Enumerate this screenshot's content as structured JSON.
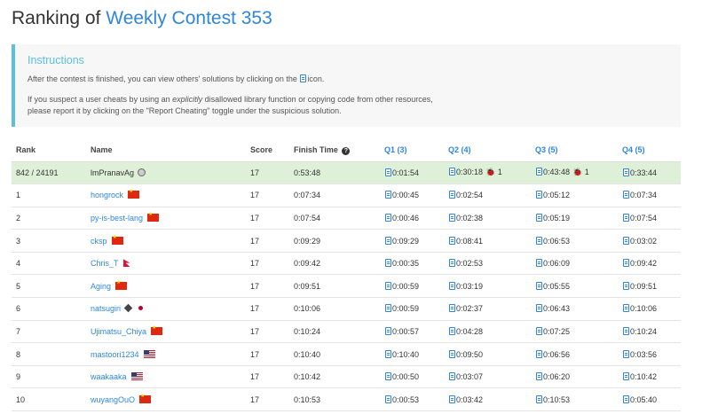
{
  "page": {
    "title_prefix": "Ranking of",
    "contest_name": "Weekly Contest 353"
  },
  "instructions": {
    "heading": "Instructions",
    "line1_before": "After the contest is finished, you can view others' solutions by clicking on the",
    "line1_after": "icon.",
    "line2_before": "If you suspect a user cheats by using an",
    "line2_emph": "explicitly",
    "line2_after": "disallowed library function or copying code from other resources,",
    "line3": "please report it by clicking on the \"Report Cheating\" toggle under the suspicious solution."
  },
  "table": {
    "headers": {
      "rank": "Rank",
      "name": "Name",
      "score": "Score",
      "finish": "Finish Time",
      "q1": "Q1 (3)",
      "q2": "Q2 (4)",
      "q3": "Q3 (5)",
      "q4": "Q4 (5)"
    },
    "rows": [
      {
        "rank": "842 / 24191",
        "name": "lmPranavAg",
        "badge": "circle-badge",
        "score": "17",
        "finish": "0:53:48",
        "q1": "0:01:54",
        "q2": "0:30:18",
        "q2_bugs": "1",
        "q3": "0:43:48",
        "q3_bugs": "1",
        "q4": "0:33:44"
      },
      {
        "rank": "1",
        "name": "hongrock",
        "flag": "cn",
        "score": "17",
        "finish": "0:07:34",
        "q1": "0:00:45",
        "q2": "0:02:54",
        "q3": "0:05:12",
        "q4": "0:07:34"
      },
      {
        "rank": "2",
        "name": "py-is-best-lang",
        "flag": "cn",
        "score": "17",
        "finish": "0:07:54",
        "q1": "0:00:46",
        "q2": "0:02:38",
        "q3": "0:05:19",
        "q4": "0:07:54"
      },
      {
        "rank": "3",
        "name": "cksp",
        "flag": "cn",
        "score": "17",
        "finish": "0:09:29",
        "q1": "0:09:29",
        "q2": "0:08:41",
        "q3": "0:06:53",
        "q4": "0:03:02"
      },
      {
        "rank": "4",
        "name": "Chris_T",
        "flag": "np",
        "score": "17",
        "finish": "0:09:42",
        "q1": "0:00:35",
        "q2": "0:02:53",
        "q3": "0:06:09",
        "q4": "0:09:42"
      },
      {
        "rank": "5",
        "name": "Aging",
        "flag": "cn",
        "score": "17",
        "finish": "0:09:51",
        "q1": "0:00:59",
        "q2": "0:03:19",
        "q3": "0:05:55",
        "q4": "0:09:51"
      },
      {
        "rank": "6",
        "name": "natsugiri",
        "badge": "cube-badge",
        "flag": "jp",
        "score": "17",
        "finish": "0:10:06",
        "q1": "0:00:59",
        "q2": "0:02:37",
        "q3": "0:06:43",
        "q4": "0:10:06"
      },
      {
        "rank": "7",
        "name": "Ujimatsu_Chiya",
        "flag": "cn",
        "score": "17",
        "finish": "0:10:24",
        "q1": "0:00:57",
        "q2": "0:04:28",
        "q3": "0:07:25",
        "q4": "0:10:24"
      },
      {
        "rank": "8",
        "name": "mastoori1234",
        "flag": "us",
        "score": "17",
        "finish": "0:10:40",
        "q1": "0:10:40",
        "q2": "0:09:50",
        "q3": "0:06:56",
        "q4": "0:03:56"
      },
      {
        "rank": "9",
        "name": "waakaaka",
        "flag": "us",
        "score": "17",
        "finish": "0:10:42",
        "q1": "0:00:50",
        "q2": "0:03:07",
        "q3": "0:06:20",
        "q4": "0:10:42"
      },
      {
        "rank": "10",
        "name": "wuyangOuO",
        "flag": "cn",
        "score": "17",
        "finish": "0:10:53",
        "q1": "0:00:53",
        "q2": "0:03:42",
        "q3": "0:10:53",
        "q4": "0:05:40"
      }
    ]
  }
}
